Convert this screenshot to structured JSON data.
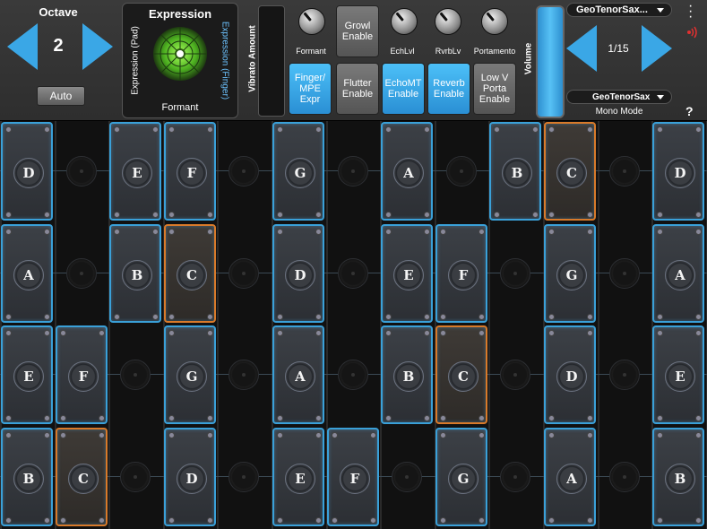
{
  "octave": {
    "title": "Octave",
    "value": "2",
    "auto_label": "Auto"
  },
  "expression": {
    "title": "Expression",
    "pad_label": "Expression (Pad)",
    "finger_label": "Expression (Finger)",
    "formant_label": "Formant"
  },
  "vibrato": {
    "label": "Vibrato Amount"
  },
  "knobs": [
    {
      "label": "Formant",
      "icon": "formant-knob"
    },
    {
      "label": "EchLvl",
      "icon": "echo-level-knob"
    },
    {
      "label": "RvrbLv",
      "icon": "reverb-level-knob"
    },
    {
      "label": "Portamento",
      "icon": "portamento-knob"
    }
  ],
  "buttons": {
    "growl": "Growl\nEnable",
    "finger": "Finger/\nMPE\nExpr",
    "flutter": "Flutter\nEnable",
    "echomt": "EchoMT\nEnable",
    "reverb": "Reverb\nEnable",
    "lowv": "Low V\nPorta\nEnable"
  },
  "volume": {
    "label": "Volume"
  },
  "preset": {
    "name": "GeoTenorSax...",
    "page": "1/15",
    "sub": "GeoTenorSax",
    "mode": "Mono Mode"
  },
  "colors": {
    "accent": "#3aa7e6",
    "pad_border": "#3aa0d8",
    "highlight_border": "#d87a2a"
  },
  "rows": [
    [
      {
        "note": "D",
        "pad": true
      },
      {
        "note": "",
        "pad": false
      },
      {
        "note": "E",
        "pad": true
      },
      {
        "note": "F",
        "pad": true
      },
      {
        "note": "",
        "pad": false
      },
      {
        "note": "G",
        "pad": true
      },
      {
        "note": "",
        "pad": false
      },
      {
        "note": "A",
        "pad": true
      },
      {
        "note": "",
        "pad": false
      },
      {
        "note": "B",
        "pad": true
      },
      {
        "note": "C",
        "pad": true,
        "highlight": true
      },
      {
        "note": "",
        "pad": false
      },
      {
        "note": "D",
        "pad": true
      }
    ],
    [
      {
        "note": "A",
        "pad": true
      },
      {
        "note": "",
        "pad": false
      },
      {
        "note": "B",
        "pad": true
      },
      {
        "note": "C",
        "pad": true,
        "highlight": true
      },
      {
        "note": "",
        "pad": false
      },
      {
        "note": "D",
        "pad": true
      },
      {
        "note": "",
        "pad": false
      },
      {
        "note": "E",
        "pad": true
      },
      {
        "note": "F",
        "pad": true
      },
      {
        "note": "",
        "pad": false
      },
      {
        "note": "G",
        "pad": true
      },
      {
        "note": "",
        "pad": false
      },
      {
        "note": "A",
        "pad": true
      }
    ],
    [
      {
        "note": "E",
        "pad": true
      },
      {
        "note": "F",
        "pad": true
      },
      {
        "note": "",
        "pad": false
      },
      {
        "note": "G",
        "pad": true
      },
      {
        "note": "",
        "pad": false
      },
      {
        "note": "A",
        "pad": true
      },
      {
        "note": "",
        "pad": false
      },
      {
        "note": "B",
        "pad": true
      },
      {
        "note": "C",
        "pad": true,
        "highlight": true
      },
      {
        "note": "",
        "pad": false
      },
      {
        "note": "D",
        "pad": true
      },
      {
        "note": "",
        "pad": false
      },
      {
        "note": "E",
        "pad": true
      }
    ],
    [
      {
        "note": "B",
        "pad": true
      },
      {
        "note": "C",
        "pad": true,
        "highlight": true
      },
      {
        "note": "",
        "pad": false
      },
      {
        "note": "D",
        "pad": true
      },
      {
        "note": "",
        "pad": false
      },
      {
        "note": "E",
        "pad": true
      },
      {
        "note": "F",
        "pad": true
      },
      {
        "note": "",
        "pad": false
      },
      {
        "note": "G",
        "pad": true
      },
      {
        "note": "",
        "pad": false
      },
      {
        "note": "A",
        "pad": true
      },
      {
        "note": "",
        "pad": false
      },
      {
        "note": "B",
        "pad": true
      }
    ]
  ]
}
